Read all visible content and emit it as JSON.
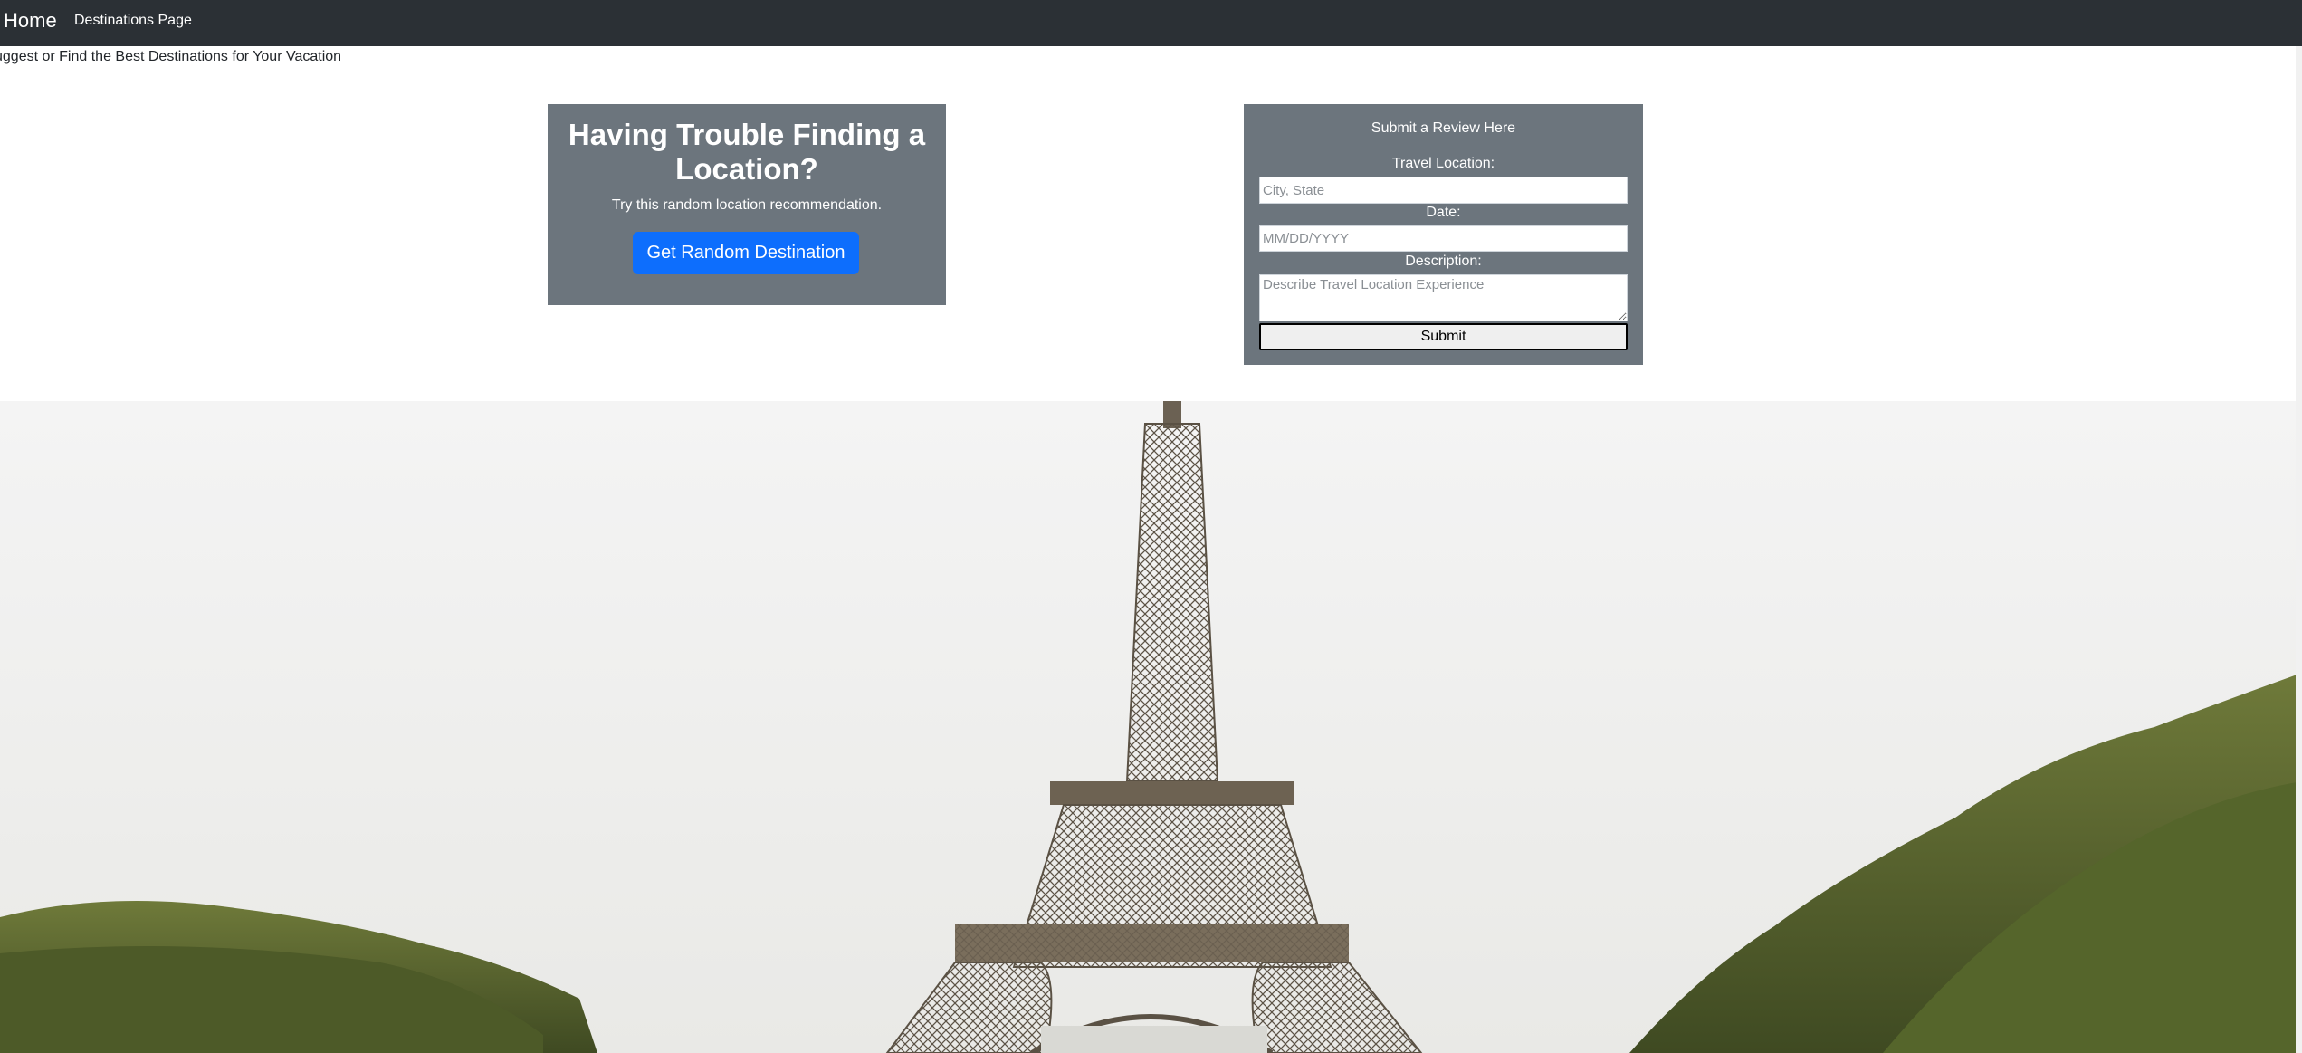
{
  "navbar": {
    "brand": "Home",
    "links": [
      "Destinations Page"
    ]
  },
  "tagline": "uggest or Find the Best Destinations for Your Vacation",
  "random_card": {
    "title": "Having Trouble Finding a Location?",
    "subtitle": "Try this random location recommendation.",
    "button_label": "Get Random Destination"
  },
  "review_form": {
    "title": "Submit a Review Here",
    "location_label": "Travel Location:",
    "location_placeholder": "City, State",
    "date_label": "Date:",
    "date_placeholder": "MM/DD/YYYY",
    "description_label": "Description:",
    "description_placeholder": "Describe Travel Location Experience",
    "submit_label": "Submit"
  },
  "colors": {
    "navbar": "#2b3035",
    "card": "#6c757d",
    "primary_button": "#0d6efd"
  },
  "hero": {
    "image_subject": "Eiffel Tower with trees"
  }
}
